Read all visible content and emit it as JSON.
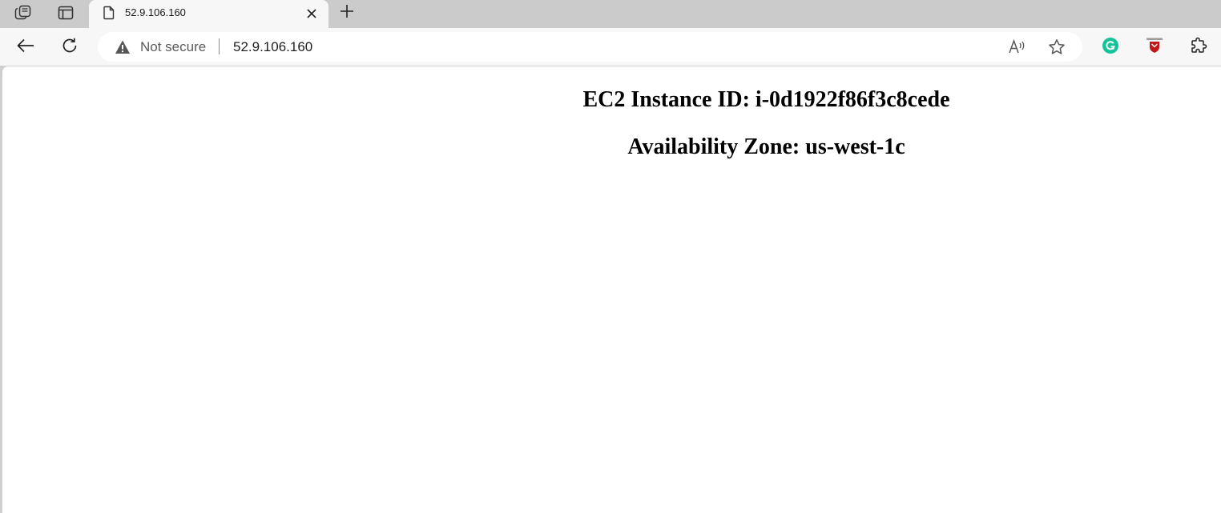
{
  "tab": {
    "title": "52.9.106.160"
  },
  "addressbar": {
    "security_label": "Not secure",
    "url": "52.9.106.160"
  },
  "page": {
    "instance_line": "EC2 Instance ID: i-0d1922f86f3c8cede",
    "zone_line": "Availability Zone: us-west-1c"
  },
  "icons": {
    "workspaces": "workspaces-icon",
    "tab_actions": "tab-actions-icon",
    "favicon": "page-icon",
    "close": "close-icon",
    "new_tab": "plus-icon",
    "back": "back-arrow-icon",
    "refresh": "refresh-icon",
    "warning": "warning-icon",
    "read_aloud": "read-aloud-icon",
    "favorite": "star-icon",
    "grammarly": "grammarly-icon",
    "mcafee": "mcafee-icon",
    "extensions": "extensions-icon"
  },
  "colors": {
    "grammarly": "#15c39a",
    "mcafee": "#c01818",
    "tabstrip": "#cbcbcb",
    "toolbar": "#f7f7f7"
  }
}
